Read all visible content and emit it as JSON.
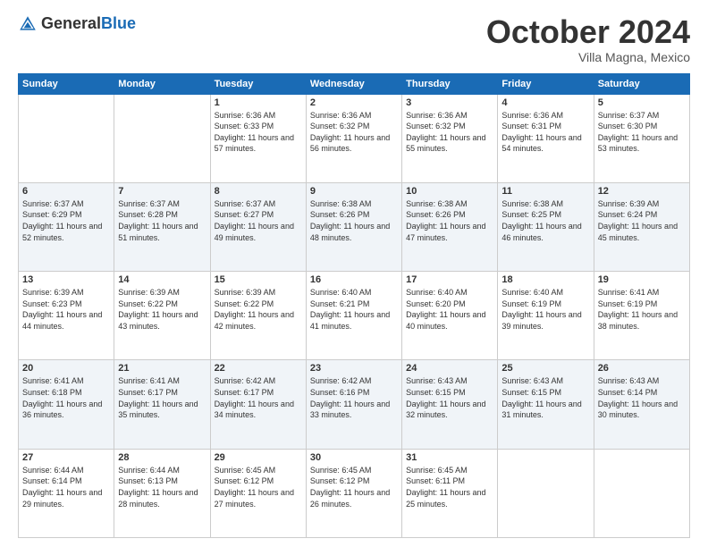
{
  "logo": {
    "general": "General",
    "blue": "Blue"
  },
  "header": {
    "month": "October 2024",
    "location": "Villa Magna, Mexico"
  },
  "days_of_week": [
    "Sunday",
    "Monday",
    "Tuesday",
    "Wednesday",
    "Thursday",
    "Friday",
    "Saturday"
  ],
  "weeks": [
    [
      {
        "day": "",
        "sunrise": "",
        "sunset": "",
        "daylight": ""
      },
      {
        "day": "",
        "sunrise": "",
        "sunset": "",
        "daylight": ""
      },
      {
        "day": "1",
        "sunrise": "Sunrise: 6:36 AM",
        "sunset": "Sunset: 6:33 PM",
        "daylight": "Daylight: 11 hours and 57 minutes."
      },
      {
        "day": "2",
        "sunrise": "Sunrise: 6:36 AM",
        "sunset": "Sunset: 6:32 PM",
        "daylight": "Daylight: 11 hours and 56 minutes."
      },
      {
        "day": "3",
        "sunrise": "Sunrise: 6:36 AM",
        "sunset": "Sunset: 6:32 PM",
        "daylight": "Daylight: 11 hours and 55 minutes."
      },
      {
        "day": "4",
        "sunrise": "Sunrise: 6:36 AM",
        "sunset": "Sunset: 6:31 PM",
        "daylight": "Daylight: 11 hours and 54 minutes."
      },
      {
        "day": "5",
        "sunrise": "Sunrise: 6:37 AM",
        "sunset": "Sunset: 6:30 PM",
        "daylight": "Daylight: 11 hours and 53 minutes."
      }
    ],
    [
      {
        "day": "6",
        "sunrise": "Sunrise: 6:37 AM",
        "sunset": "Sunset: 6:29 PM",
        "daylight": "Daylight: 11 hours and 52 minutes."
      },
      {
        "day": "7",
        "sunrise": "Sunrise: 6:37 AM",
        "sunset": "Sunset: 6:28 PM",
        "daylight": "Daylight: 11 hours and 51 minutes."
      },
      {
        "day": "8",
        "sunrise": "Sunrise: 6:37 AM",
        "sunset": "Sunset: 6:27 PM",
        "daylight": "Daylight: 11 hours and 49 minutes."
      },
      {
        "day": "9",
        "sunrise": "Sunrise: 6:38 AM",
        "sunset": "Sunset: 6:26 PM",
        "daylight": "Daylight: 11 hours and 48 minutes."
      },
      {
        "day": "10",
        "sunrise": "Sunrise: 6:38 AM",
        "sunset": "Sunset: 6:26 PM",
        "daylight": "Daylight: 11 hours and 47 minutes."
      },
      {
        "day": "11",
        "sunrise": "Sunrise: 6:38 AM",
        "sunset": "Sunset: 6:25 PM",
        "daylight": "Daylight: 11 hours and 46 minutes."
      },
      {
        "day": "12",
        "sunrise": "Sunrise: 6:39 AM",
        "sunset": "Sunset: 6:24 PM",
        "daylight": "Daylight: 11 hours and 45 minutes."
      }
    ],
    [
      {
        "day": "13",
        "sunrise": "Sunrise: 6:39 AM",
        "sunset": "Sunset: 6:23 PM",
        "daylight": "Daylight: 11 hours and 44 minutes."
      },
      {
        "day": "14",
        "sunrise": "Sunrise: 6:39 AM",
        "sunset": "Sunset: 6:22 PM",
        "daylight": "Daylight: 11 hours and 43 minutes."
      },
      {
        "day": "15",
        "sunrise": "Sunrise: 6:39 AM",
        "sunset": "Sunset: 6:22 PM",
        "daylight": "Daylight: 11 hours and 42 minutes."
      },
      {
        "day": "16",
        "sunrise": "Sunrise: 6:40 AM",
        "sunset": "Sunset: 6:21 PM",
        "daylight": "Daylight: 11 hours and 41 minutes."
      },
      {
        "day": "17",
        "sunrise": "Sunrise: 6:40 AM",
        "sunset": "Sunset: 6:20 PM",
        "daylight": "Daylight: 11 hours and 40 minutes."
      },
      {
        "day": "18",
        "sunrise": "Sunrise: 6:40 AM",
        "sunset": "Sunset: 6:19 PM",
        "daylight": "Daylight: 11 hours and 39 minutes."
      },
      {
        "day": "19",
        "sunrise": "Sunrise: 6:41 AM",
        "sunset": "Sunset: 6:19 PM",
        "daylight": "Daylight: 11 hours and 38 minutes."
      }
    ],
    [
      {
        "day": "20",
        "sunrise": "Sunrise: 6:41 AM",
        "sunset": "Sunset: 6:18 PM",
        "daylight": "Daylight: 11 hours and 36 minutes."
      },
      {
        "day": "21",
        "sunrise": "Sunrise: 6:41 AM",
        "sunset": "Sunset: 6:17 PM",
        "daylight": "Daylight: 11 hours and 35 minutes."
      },
      {
        "day": "22",
        "sunrise": "Sunrise: 6:42 AM",
        "sunset": "Sunset: 6:17 PM",
        "daylight": "Daylight: 11 hours and 34 minutes."
      },
      {
        "day": "23",
        "sunrise": "Sunrise: 6:42 AM",
        "sunset": "Sunset: 6:16 PM",
        "daylight": "Daylight: 11 hours and 33 minutes."
      },
      {
        "day": "24",
        "sunrise": "Sunrise: 6:43 AM",
        "sunset": "Sunset: 6:15 PM",
        "daylight": "Daylight: 11 hours and 32 minutes."
      },
      {
        "day": "25",
        "sunrise": "Sunrise: 6:43 AM",
        "sunset": "Sunset: 6:15 PM",
        "daylight": "Daylight: 11 hours and 31 minutes."
      },
      {
        "day": "26",
        "sunrise": "Sunrise: 6:43 AM",
        "sunset": "Sunset: 6:14 PM",
        "daylight": "Daylight: 11 hours and 30 minutes."
      }
    ],
    [
      {
        "day": "27",
        "sunrise": "Sunrise: 6:44 AM",
        "sunset": "Sunset: 6:14 PM",
        "daylight": "Daylight: 11 hours and 29 minutes."
      },
      {
        "day": "28",
        "sunrise": "Sunrise: 6:44 AM",
        "sunset": "Sunset: 6:13 PM",
        "daylight": "Daylight: 11 hours and 28 minutes."
      },
      {
        "day": "29",
        "sunrise": "Sunrise: 6:45 AM",
        "sunset": "Sunset: 6:12 PM",
        "daylight": "Daylight: 11 hours and 27 minutes."
      },
      {
        "day": "30",
        "sunrise": "Sunrise: 6:45 AM",
        "sunset": "Sunset: 6:12 PM",
        "daylight": "Daylight: 11 hours and 26 minutes."
      },
      {
        "day": "31",
        "sunrise": "Sunrise: 6:45 AM",
        "sunset": "Sunset: 6:11 PM",
        "daylight": "Daylight: 11 hours and 25 minutes."
      },
      {
        "day": "",
        "sunrise": "",
        "sunset": "",
        "daylight": ""
      },
      {
        "day": "",
        "sunrise": "",
        "sunset": "",
        "daylight": ""
      }
    ]
  ]
}
